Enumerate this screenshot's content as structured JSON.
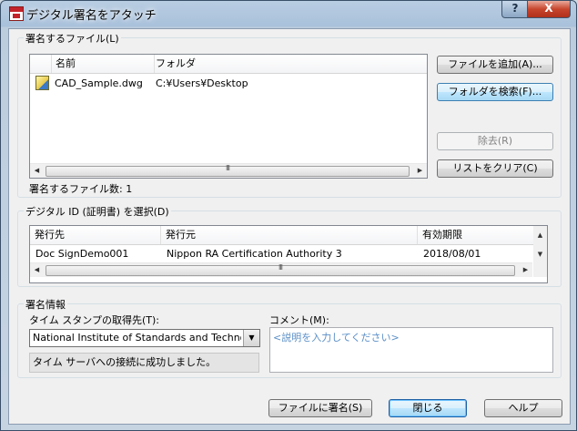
{
  "window": {
    "title": "デジタル署名をアタッチ",
    "help_glyph": "?",
    "close_glyph": "X"
  },
  "files_group": {
    "label": "署名するファイル(L)",
    "columns": [
      "名前",
      "フォルダ"
    ],
    "rows": [
      {
        "name": "CAD_Sample.dwg",
        "folder": "C:¥Users¥Desktop"
      }
    ],
    "count_label": "署名するファイル数: 1",
    "buttons": {
      "add_files": "ファイルを追加(A)...",
      "search_folder": "フォルダを検索(F)...",
      "remove": "除去(R)",
      "clear_list": "リストをクリア(C)"
    }
  },
  "id_group": {
    "label": "デジタル ID (証明書) を選択(D)",
    "columns": [
      "発行先",
      "発行元",
      "有効期限"
    ],
    "rows": [
      {
        "issued_to": "Doc SignDemo001",
        "issued_by": "Nippon RA Certification Authority 3",
        "expires": "2018/08/01"
      }
    ]
  },
  "sign_group": {
    "label": "署名情報",
    "timestamp_label": "タイム スタンプの取得先(T):",
    "timestamp_value": "National Institute of Standards and Technology",
    "status_text": "タイム サーバへの接続に成功しました。",
    "comment_label": "コメント(M):",
    "comment_placeholder": "<説明を入力してください>"
  },
  "footer": {
    "sign_button": "ファイルに署名(S)",
    "close_button": "閉じる",
    "help_button": "ヘルプ"
  },
  "scroll": {
    "left_arrow": "◀",
    "right_arrow": "▶",
    "up_arrow": "▲",
    "down_arrow": "▼",
    "grip": "III",
    "dropdown_arrow": "▼"
  }
}
